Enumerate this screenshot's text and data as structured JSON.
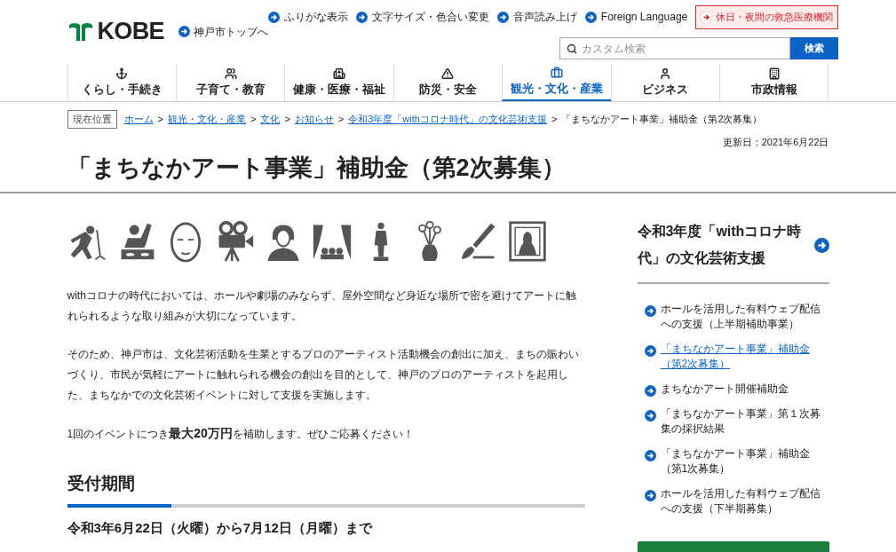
{
  "header": {
    "logo": "KOBE",
    "top_link": "神戸市トップへ",
    "utility_links": [
      "ふりがな表示",
      "文字サイズ・色合い変更",
      "音声読み上げ",
      "Foreign Language"
    ],
    "emergency_link": "休日・夜間の救急医療機関",
    "search": {
      "placeholder": "カスタム検索",
      "button": "検索"
    }
  },
  "nav": [
    {
      "kind": "anchor",
      "label": "くらし・手続き",
      "selected": false
    },
    {
      "kind": "people",
      "label": "子育て・教育",
      "selected": false
    },
    {
      "kind": "hospital",
      "label": "健康・医療・福祉",
      "selected": false
    },
    {
      "kind": "warning",
      "label": "防災・安全",
      "selected": false
    },
    {
      "kind": "suitcase",
      "label": "観光・文化・産業",
      "selected": true
    },
    {
      "kind": "person",
      "label": "ビジネス",
      "selected": false
    },
    {
      "kind": "building",
      "label": "市政情報",
      "selected": false
    }
  ],
  "breadcrumb": {
    "label": "現在位置",
    "separator": ">",
    "links": [
      "ホーム",
      "観光・文化・産業",
      "文化",
      "お知らせ",
      "令和3年度「withコロナ時代」の文化芸術支援"
    ],
    "current": "「まちなかアート事業」補助金（第2次募集）"
  },
  "updated": "更新日：2021年6月22日",
  "title": "「まちなかアート事業」補助金（第2次募集）",
  "paragraphs": [
    "withコロナの時代においては、ホールや劇場のみならず、屋外空間など身近な場所で密を避けてアートに触れられるような取り組みが大切になっています。",
    "そのため、神戸市は、文化芸術活動を生業とするプロのアーティスト活動機会の創出に加え、まちの賑わいづくり、市民が気軽にアートに触れられる機会の創出を目的として、神戸のプロのアーティストを起用した、まちなかでの文化芸術イベントに対して支援を実施します。",
    "1回のイベントにつき**最大20万円**を補助します。ぜひご応募ください！"
  ],
  "section": {
    "heading": "受付期間",
    "text": "令和3年6月22日（火曜）から7月12日（月曜）まで"
  },
  "sidebar": {
    "title": "令和3年度「withコロナ時代」の文化芸術支援",
    "items": [
      {
        "label": "ホールを活用した有料ウェブ配信への支援（上半期補助事業）",
        "selected": false
      },
      {
        "label": "「まちなかアート事業」補助金（第2次募集）",
        "selected": true
      },
      {
        "label": "まちなかアート開催補助金",
        "selected": false
      },
      {
        "label": "「まちなかアート事業」第１次募集の採択結果",
        "selected": false
      },
      {
        "label": "「まちなかアート事業」補助金（第1次募集）",
        "selected": false
      },
      {
        "label": "ホールを活用した有料ウェブ配信への支援（下半期募集）",
        "selected": false
      }
    ]
  }
}
